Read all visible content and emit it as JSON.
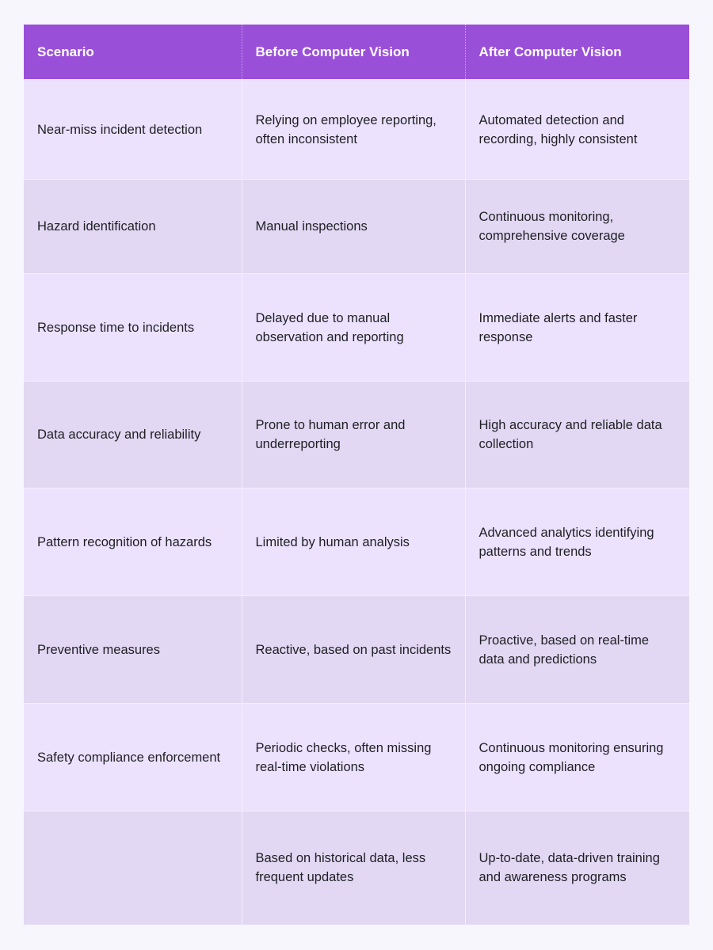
{
  "table": {
    "headers": [
      "Scenario",
      "Before Computer Vision",
      "After Computer Vision"
    ],
    "rows": [
      [
        "Near-miss incident detection",
        "Relying on employee reporting, often inconsistent",
        "Automated detection and recording, highly consistent"
      ],
      [
        "Hazard identification",
        "Manual inspections",
        "Continuous monitoring, comprehensive coverage"
      ],
      [
        "Response time to incidents",
        "Delayed due to manual observation and reporting",
        "Immediate alerts and faster response"
      ],
      [
        "Data accuracy and reliability",
        "Prone to human error and underreporting",
        "High accuracy and reliable data collection"
      ],
      [
        "Pattern recognition of hazards",
        "Limited by human analysis",
        "Advanced analytics identifying patterns and trends"
      ],
      [
        "Preventive measures",
        "Reactive, based on past incidents",
        "Proactive, based on real-time data and predictions"
      ],
      [
        "Safety compliance enforcement",
        "Periodic checks, often missing real-time violations",
        "Continuous monitoring ensuring ongoing compliance"
      ],
      [
        "",
        "Based on historical data, less frequent updates",
        "Up-to-date, data-driven training and awareness programs"
      ]
    ]
  },
  "colors": {
    "header_bg": "#9a4fd9",
    "header_text": "#ffffff",
    "row_odd_bg": "#ece2fd",
    "row_even_bg": "#e2d8f3",
    "page_bg": "#f8f6fd"
  }
}
